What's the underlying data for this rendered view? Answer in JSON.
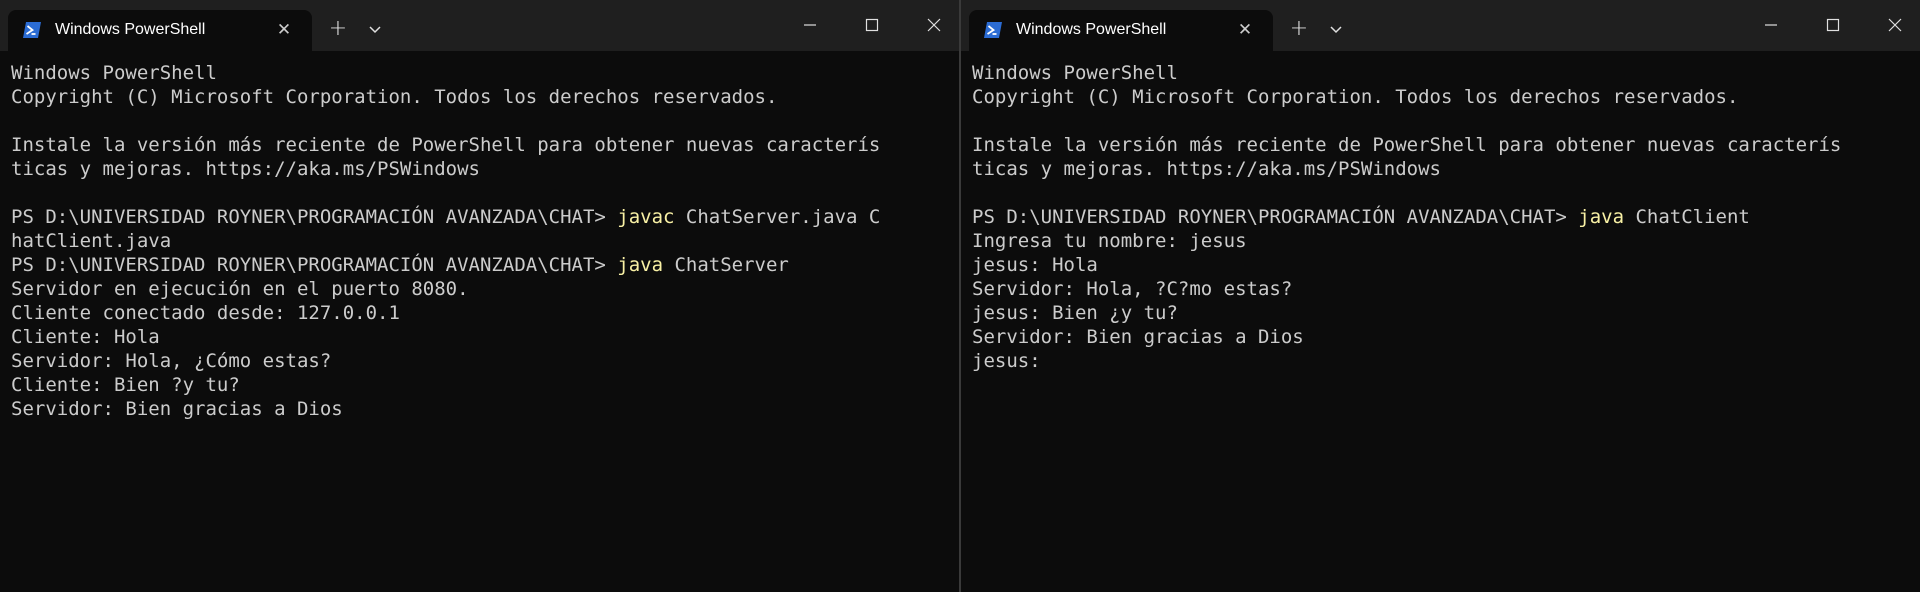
{
  "left_window": {
    "tab_title": "Windows PowerShell",
    "lines": [
      [
        {
          "t": "Windows PowerShell"
        }
      ],
      [
        {
          "t": "Copyright (C) Microsoft Corporation. Todos los derechos reservados."
        }
      ],
      [
        {
          "t": ""
        }
      ],
      [
        {
          "t": "Instale la versión más reciente de PowerShell para obtener nuevas caracterís"
        }
      ],
      [
        {
          "t": "ticas y mejoras. https://aka.ms/PSWindows"
        }
      ],
      [
        {
          "t": ""
        }
      ],
      [
        {
          "t": "PS D:\\UNIVERSIDAD ROYNER\\PROGRAMACIÓN AVANZADA\\CHAT> "
        },
        {
          "t": "javac",
          "cmd": true
        },
        {
          "t": " ChatServer.java C"
        }
      ],
      [
        {
          "t": "hatClient.java"
        }
      ],
      [
        {
          "t": "PS D:\\UNIVERSIDAD ROYNER\\PROGRAMACIÓN AVANZADA\\CHAT> "
        },
        {
          "t": "java",
          "cmd": true
        },
        {
          "t": " ChatServer"
        }
      ],
      [
        {
          "t": "Servidor en ejecución en el puerto 8080."
        }
      ],
      [
        {
          "t": "Cliente conectado desde: 127.0.0.1"
        }
      ],
      [
        {
          "t": "Cliente: Hola"
        }
      ],
      [
        {
          "t": "Servidor: Hola, ¿Cómo estas?"
        }
      ],
      [
        {
          "t": "Cliente: Bien ?y tu?"
        }
      ],
      [
        {
          "t": "Servidor: Bien gracias a Dios"
        }
      ]
    ]
  },
  "right_window": {
    "tab_title": "Windows PowerShell",
    "lines": [
      [
        {
          "t": "Windows PowerShell"
        }
      ],
      [
        {
          "t": "Copyright (C) Microsoft Corporation. Todos los derechos reservados."
        }
      ],
      [
        {
          "t": ""
        }
      ],
      [
        {
          "t": "Instale la versión más reciente de PowerShell para obtener nuevas caracterís"
        }
      ],
      [
        {
          "t": "ticas y mejoras. https://aka.ms/PSWindows"
        }
      ],
      [
        {
          "t": ""
        }
      ],
      [
        {
          "t": "PS D:\\UNIVERSIDAD ROYNER\\PROGRAMACIÓN AVANZADA\\CHAT> "
        },
        {
          "t": "java",
          "cmd": true
        },
        {
          "t": " ChatClient"
        }
      ],
      [
        {
          "t": "Ingresa tu nombre: jesus"
        }
      ],
      [
        {
          "t": "jesus: Hola"
        }
      ],
      [
        {
          "t": "Servidor: Hola, ?C?mo estas?"
        }
      ],
      [
        {
          "t": "jesus: Bien ¿y tu?"
        }
      ],
      [
        {
          "t": "Servidor: Bien gracias a Dios"
        }
      ],
      [
        {
          "t": "jesus: "
        }
      ]
    ]
  },
  "icons": {
    "tab_icon": "powershell-icon",
    "tab_close": "close-icon",
    "new_tab": "plus-icon",
    "tab_dropdown": "chevron-down-icon",
    "minimize": "minimize-icon",
    "maximize": "maximize-icon",
    "close": "close-icon"
  },
  "colors": {
    "terminal_bg": "#0c0c0c",
    "titlebar_bg": "#1f1f1f",
    "text": "#cccccc",
    "command": "#f9f1a5",
    "powershell_blue": "#2b6cd4"
  }
}
